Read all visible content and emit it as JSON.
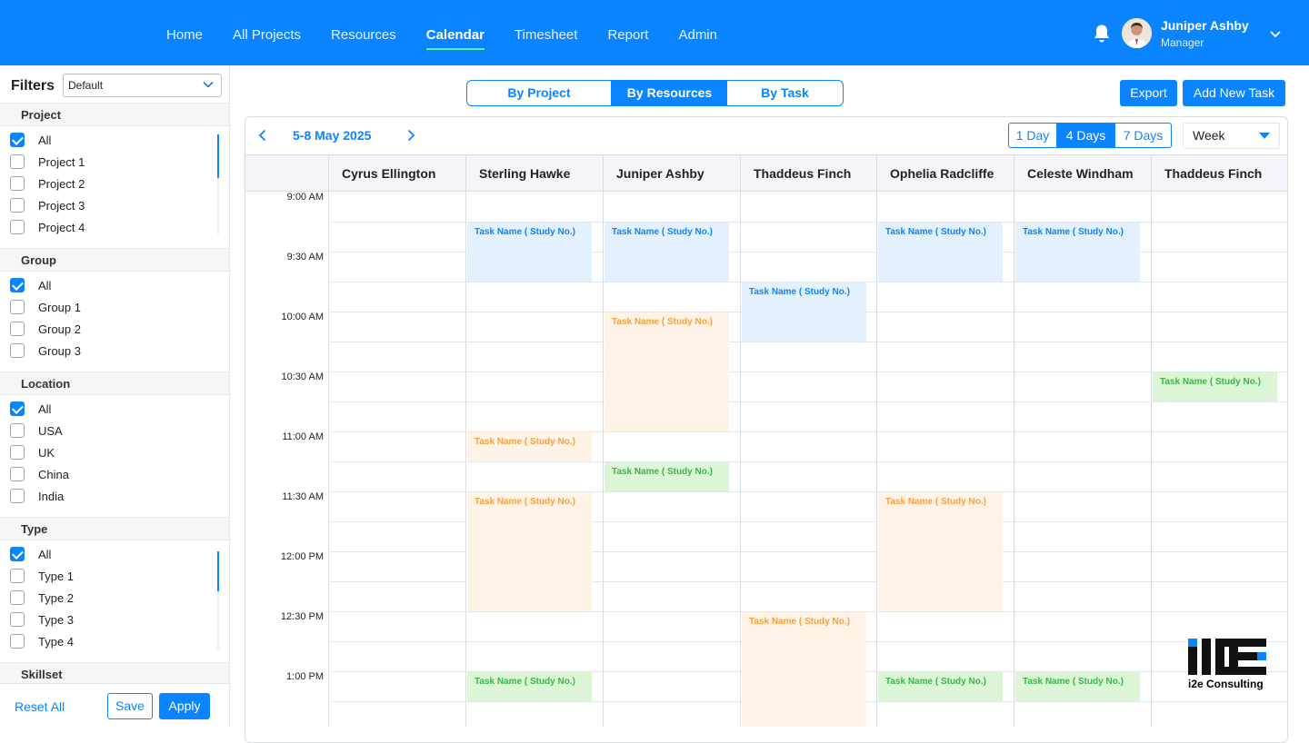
{
  "nav": {
    "items": [
      "Home",
      "All Projects",
      "Resources",
      "Calendar",
      "Timesheet",
      "Report",
      "Admin"
    ],
    "active": "Calendar"
  },
  "user": {
    "name": "Juniper Ashby",
    "role": "Manager"
  },
  "filters": {
    "title": "Filters",
    "preset": "Default",
    "groups": [
      {
        "label": "Project",
        "options": [
          "All",
          "Project 1",
          "Project 2",
          "Project 3",
          "Project 4"
        ]
      },
      {
        "label": "Group",
        "options": [
          "All",
          "Group 1",
          "Group 2",
          "Group 3"
        ]
      },
      {
        "label": "Location",
        "options": [
          "All",
          "USA",
          "UK",
          "China",
          "India"
        ]
      },
      {
        "label": "Type",
        "options": [
          "All",
          "Type 1",
          "Type 2",
          "Type 3",
          "Type 4"
        ]
      },
      {
        "label": "Skillset",
        "options": []
      }
    ],
    "reset_label": "Reset All",
    "save_label": "Save",
    "apply_label": "Apply"
  },
  "view_tabs": [
    "By Project",
    "By Resources",
    "By Task"
  ],
  "active_view": "By Resources",
  "actions": {
    "export": "Export",
    "add_task": "Add New Task"
  },
  "calendar": {
    "date_range": "5-8 May 2025",
    "day_ranges": [
      "1 Day",
      "4 Days",
      "7 Days"
    ],
    "active_range": "4 Days",
    "period": "Week",
    "resources": [
      "Cyrus Ellington",
      "Sterling Hawke",
      "Juniper Ashby",
      "Thaddeus Finch",
      "Ophelia Radcliffe",
      "Celeste Windham",
      "Thaddeus Finch"
    ],
    "times": [
      "9:00 AM",
      "9:30 AM",
      "10:00 AM",
      "10:30 AM",
      "11:00 AM",
      "11:30 AM",
      "12:00 PM",
      "12:30 PM",
      "1:00 PM"
    ],
    "task_label": "Task Name ( Study No.)",
    "colors": {
      "blue": "#e2f1fd",
      "orange": "#fef3e6",
      "green": "#dcf5d6",
      "accent": "#0a84ff"
    },
    "events": [
      {
        "col": 1,
        "start": 1,
        "span": 2,
        "color": "blue"
      },
      {
        "col": 1,
        "start": 8,
        "span": 1,
        "color": "orange"
      },
      {
        "col": 1,
        "start": 10,
        "span": 4,
        "color": "orange"
      },
      {
        "col": 1,
        "start": 16,
        "span": 1,
        "color": "green"
      },
      {
        "col": 2,
        "start": 1,
        "span": 2,
        "color": "blue"
      },
      {
        "col": 2,
        "start": 4,
        "span": 4,
        "color": "orange"
      },
      {
        "col": 2,
        "start": 9,
        "span": 1,
        "color": "green"
      },
      {
        "col": 3,
        "start": 3,
        "span": 2,
        "color": "blue"
      },
      {
        "col": 3,
        "start": 14,
        "span": 4,
        "color": "orange"
      },
      {
        "col": 4,
        "start": 1,
        "span": 2,
        "color": "blue"
      },
      {
        "col": 4,
        "start": 10,
        "span": 4,
        "color": "orange"
      },
      {
        "col": 4,
        "start": 16,
        "span": 1,
        "color": "green"
      },
      {
        "col": 5,
        "start": 1,
        "span": 2,
        "color": "blue"
      },
      {
        "col": 5,
        "start": 16,
        "span": 1,
        "color": "green"
      },
      {
        "col": 6,
        "start": 6,
        "span": 1,
        "color": "green"
      }
    ]
  },
  "brand": {
    "name": "i2e Consulting"
  }
}
